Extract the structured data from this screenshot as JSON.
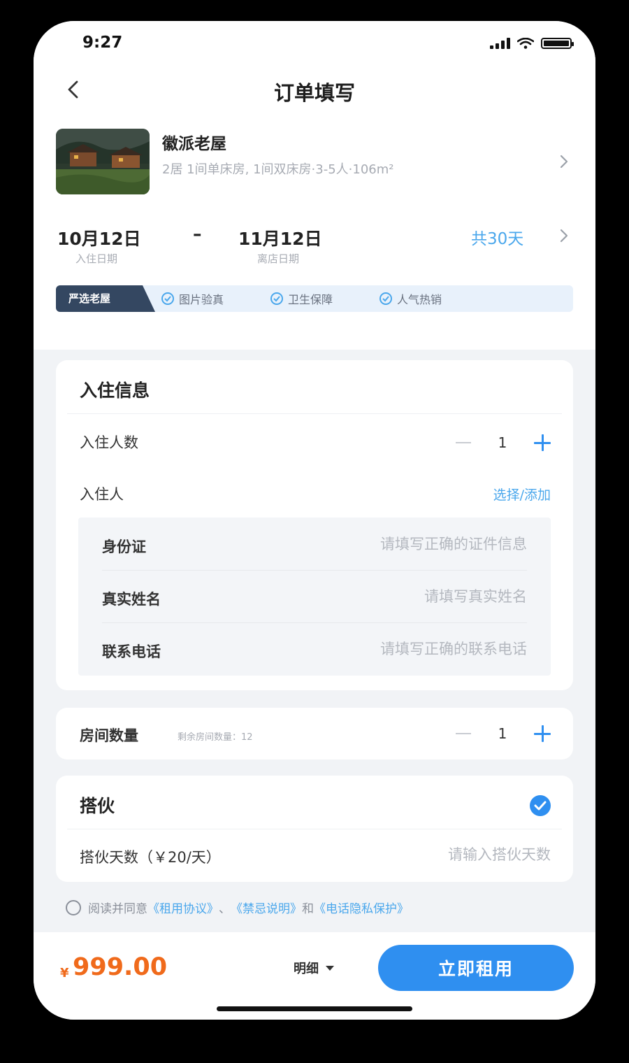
{
  "status_bar": {
    "time": "9:27"
  },
  "header": {
    "title": "订单填写"
  },
  "listing": {
    "name": "徽派老屋",
    "description": "2居  1间单床房, 1间双床房·3-5人·106m²"
  },
  "dates": {
    "check_in": "10月12日",
    "check_in_label": "入住日期",
    "separator": "–",
    "check_out": "11月12日",
    "check_out_label": "离店日期",
    "total": "共30天"
  },
  "features": {
    "badge": "严选老屋",
    "items": [
      "图片验真",
      "卫生保障",
      "人气热销"
    ]
  },
  "checkin_info": {
    "title": "入住信息",
    "guest_count_label": "入住人数",
    "guest_count": "1",
    "guest_label": "入住人",
    "select_add": "选择/添加",
    "fields": [
      {
        "label": "身份证",
        "placeholder": "请填写正确的证件信息"
      },
      {
        "label": "真实姓名",
        "placeholder": "请填写真实姓名"
      },
      {
        "label": "联系电话",
        "placeholder": "请填写正确的联系电话"
      }
    ]
  },
  "rooms": {
    "label": "房间数量",
    "remaining": "剩余房间数量：12",
    "count": "1"
  },
  "partner": {
    "title": "搭伙",
    "checked": true,
    "days_label": "搭伙天数（￥20/天）",
    "days_placeholder": "请输入搭伙天数"
  },
  "agreement": {
    "prefix": "阅读并同意",
    "link1": "《租用协议》",
    "sep": "、",
    "link2": "《禁忌说明》",
    "and": "和",
    "link3": "《电话隐私保护》"
  },
  "bottom_bar": {
    "currency": "¥",
    "price": "999.00",
    "detail": "明细",
    "cta": "立即租用"
  },
  "colors": {
    "accent": "#2f8ff0",
    "link": "#4aa7ec",
    "price": "#f06a1b",
    "badge": "#344761"
  }
}
